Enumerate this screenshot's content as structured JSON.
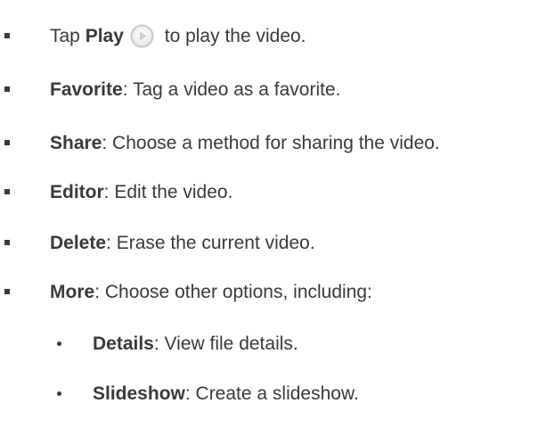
{
  "items": [
    {
      "pre": "Tap ",
      "term": "Play",
      "post": " to play the video.",
      "icon": "play-icon"
    },
    {
      "term": "Favorite",
      "desc": ": Tag a video as a favorite."
    },
    {
      "term": "Share",
      "desc": ": Choose a method for sharing the video."
    },
    {
      "term": "Editor",
      "desc": ": Edit the video."
    },
    {
      "term": "Delete",
      "desc": ": Erase the current video."
    },
    {
      "term": "More",
      "desc": ": Choose other options, including:"
    }
  ],
  "subitems": [
    {
      "term": "Details",
      "desc": ": View file details."
    },
    {
      "term": "Slideshow",
      "desc": ": Create a slideshow."
    }
  ],
  "colors": {
    "text": "#3a3a3a",
    "icon_ring": "#c9c9c9"
  }
}
